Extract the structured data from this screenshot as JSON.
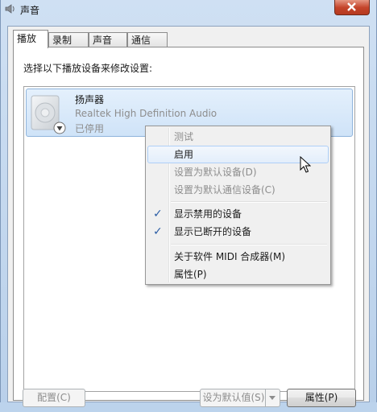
{
  "window": {
    "title": "声音"
  },
  "tabs": [
    {
      "label": "播放",
      "active": true
    },
    {
      "label": "录制",
      "active": false
    },
    {
      "label": "声音",
      "active": false
    },
    {
      "label": "通信",
      "active": false
    }
  ],
  "playback": {
    "instruction": "选择以下播放设备来修改设置:",
    "device": {
      "name": "扬声器",
      "driver": "Realtek High Definition Audio",
      "status": "已停用"
    }
  },
  "context_menu": {
    "items": [
      {
        "label": "测试",
        "enabled": false,
        "checked": false
      },
      {
        "label": "启用",
        "enabled": true,
        "checked": false,
        "hover": true
      },
      {
        "label": "设置为默认设备(D)",
        "enabled": false,
        "checked": false
      },
      {
        "label": "设置为默认通信设备(C)",
        "enabled": false,
        "checked": false
      },
      {
        "label": "显示禁用的设备",
        "enabled": true,
        "checked": true
      },
      {
        "label": "显示已断开的设备",
        "enabled": true,
        "checked": true
      },
      {
        "label": "关于软件 MIDI 合成器(M)",
        "enabled": true,
        "checked": false
      },
      {
        "label": "属性(P)",
        "enabled": true,
        "checked": false
      }
    ],
    "check_glyph": "✓"
  },
  "buttons": {
    "configure": "配置(C)",
    "set_default": "设为默认值(S)",
    "properties": "属性(P)"
  },
  "colors": {
    "selection": "#cfe3f8",
    "check": "#2b5da5",
    "close": "#c4442a"
  }
}
